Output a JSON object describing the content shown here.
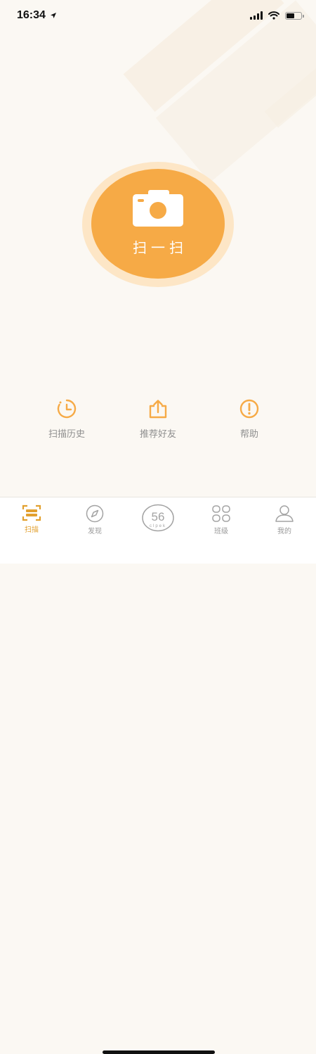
{
  "status": {
    "time": "16:34"
  },
  "scan": {
    "label": "扫一扫"
  },
  "actions": [
    {
      "label": "扫描历史",
      "icon": "clock-icon"
    },
    {
      "label": "推荐好友",
      "icon": "share-icon"
    },
    {
      "label": "帮助",
      "icon": "help-icon"
    }
  ],
  "tabs": [
    {
      "label": "扫描",
      "icon": "scan-tab-icon",
      "active": true
    },
    {
      "label": "发现",
      "icon": "compass-icon",
      "active": false
    },
    {
      "label": "56",
      "sublabel": "clpek",
      "icon": "56-logo-icon",
      "active": false
    },
    {
      "label": "班级",
      "icon": "grid-icon",
      "active": false
    },
    {
      "label": "我的",
      "icon": "user-icon",
      "active": false
    }
  ],
  "colors": {
    "accent": "#f6aa46",
    "accent_light": "#fde6c6",
    "active_tab": "#e2a02f",
    "background": "#fbf8f3"
  }
}
